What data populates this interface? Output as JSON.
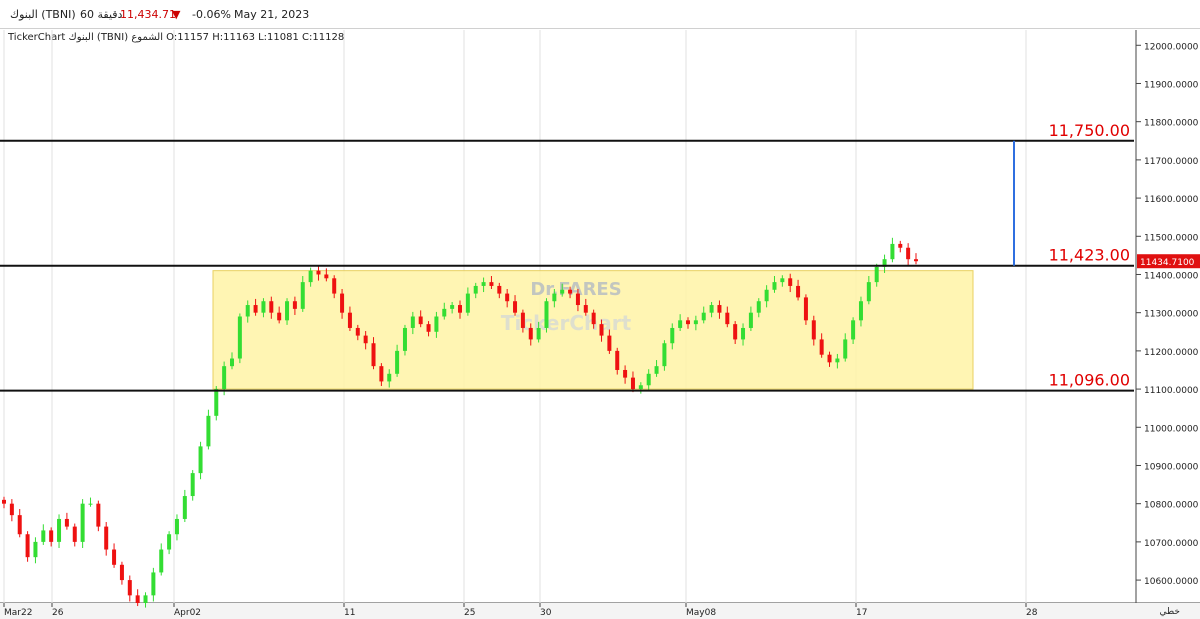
{
  "header": {
    "symbol": "البنوك (TBNI)",
    "interval": "60 دقيقة",
    "last_price": "11,434.71",
    "change_pct": "-0.06%",
    "date": "May 21, 2023",
    "down_color": "#cc0000"
  },
  "subheader": {
    "source": "TickerChart",
    "symbol": "البنوك (TBNI)",
    "chart_kind": "الشموع",
    "ohlc": "O:11157 H:11163 L:11081 C:11128"
  },
  "chart_data": {
    "type": "candlestick",
    "ylim": [
      10540,
      12040
    ],
    "y_ticks": [
      "12000.0000",
      "11900.0000",
      "11800.0000",
      "11700.0000",
      "11600.0000",
      "11500.0000",
      "11400.0000",
      "11300.0000",
      "11200.0000",
      "11100.0000",
      "11000.0000",
      "10900.0000",
      "10800.0000",
      "10700.0000",
      "10600.0000"
    ],
    "x_ticks": [
      "Mar22",
      "26",
      "Apr02",
      "11",
      "25",
      "30",
      "May08",
      "17",
      "28"
    ],
    "last_price_tag": "11434.7100",
    "footer_label": "خطي",
    "levels": [
      {
        "value": 11750,
        "label": "11,750.00"
      },
      {
        "value": 11423,
        "label": "11,423.00"
      },
      {
        "value": 11096,
        "label": "11,096.00"
      }
    ],
    "range_zone": {
      "low": 11100,
      "high": 11410,
      "color": "#fff3a6"
    },
    "target_line": {
      "from": 11423,
      "to": 11750,
      "color": "#2f6fe0"
    },
    "watermark": [
      "Dr.FARES",
      "TickerChart"
    ],
    "up_color": "#33dd33",
    "down_color": "#ee1111",
    "closes": [
      10800,
      10770,
      10720,
      10660,
      10700,
      10730,
      10700,
      10760,
      10740,
      10700,
      10800,
      10800,
      10740,
      10680,
      10640,
      10600,
      10560,
      10540,
      10560,
      10620,
      10680,
      10720,
      10760,
      10820,
      10880,
      10950,
      11030,
      11100,
      11160,
      11180,
      11290,
      11320,
      11300,
      11330,
      11300,
      11280,
      11330,
      11310,
      11380,
      11410,
      11400,
      11390,
      11350,
      11300,
      11260,
      11240,
      11220,
      11160,
      11120,
      11140,
      11200,
      11260,
      11290,
      11270,
      11250,
      11290,
      11310,
      11320,
      11300,
      11350,
      11370,
      11380,
      11370,
      11350,
      11330,
      11300,
      11260,
      11230,
      11260,
      11330,
      11350,
      11360,
      11350,
      11320,
      11300,
      11270,
      11240,
      11200,
      11150,
      11130,
      11100,
      11110,
      11140,
      11160,
      11220,
      11260,
      11280,
      11270,
      11280,
      11300,
      11320,
      11300,
      11270,
      11230,
      11260,
      11300,
      11330,
      11360,
      11380,
      11390,
      11370,
      11340,
      11280,
      11230,
      11190,
      11170,
      11180,
      11230,
      11280,
      11330,
      11380,
      11420,
      11440,
      11480,
      11470,
      11440,
      11434.71
    ]
  }
}
